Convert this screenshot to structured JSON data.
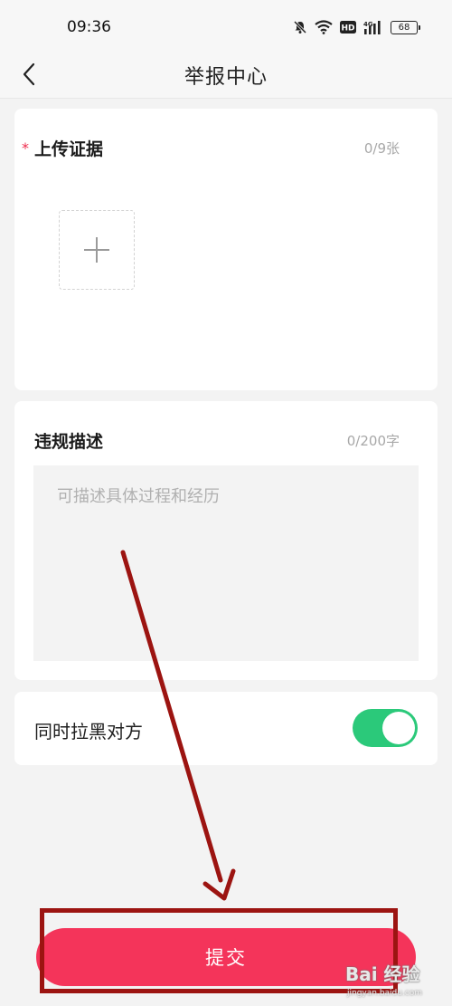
{
  "status_bar": {
    "time": "09:36",
    "icons": [
      "mute-bell-icon",
      "wifi-icon",
      "hd-icon",
      "4g-signal-icon",
      "battery-icon"
    ],
    "hd_label": "HD",
    "network_label": "4G",
    "battery_level": "68"
  },
  "header": {
    "title": "举报中心",
    "back_icon": "chevron-left-icon"
  },
  "upload_section": {
    "required_mark": "*",
    "label": "上传证据",
    "count": "0/9张",
    "add_icon": "plus-icon"
  },
  "description_section": {
    "label": "违规描述",
    "count": "0/200字",
    "placeholder": "可描述具体过程和经历",
    "value": ""
  },
  "block_option": {
    "label": "同时拉黑对方",
    "enabled": true
  },
  "submit": {
    "label": "提交"
  },
  "watermark": {
    "text": "Bai 经验",
    "url": "jingyan.baidu.com"
  },
  "colors": {
    "accent": "#f4345a",
    "toggle_on": "#2bc97a",
    "required": "#ee2c4d",
    "annotation": "#9c1411",
    "background": "#f3f3f3"
  }
}
